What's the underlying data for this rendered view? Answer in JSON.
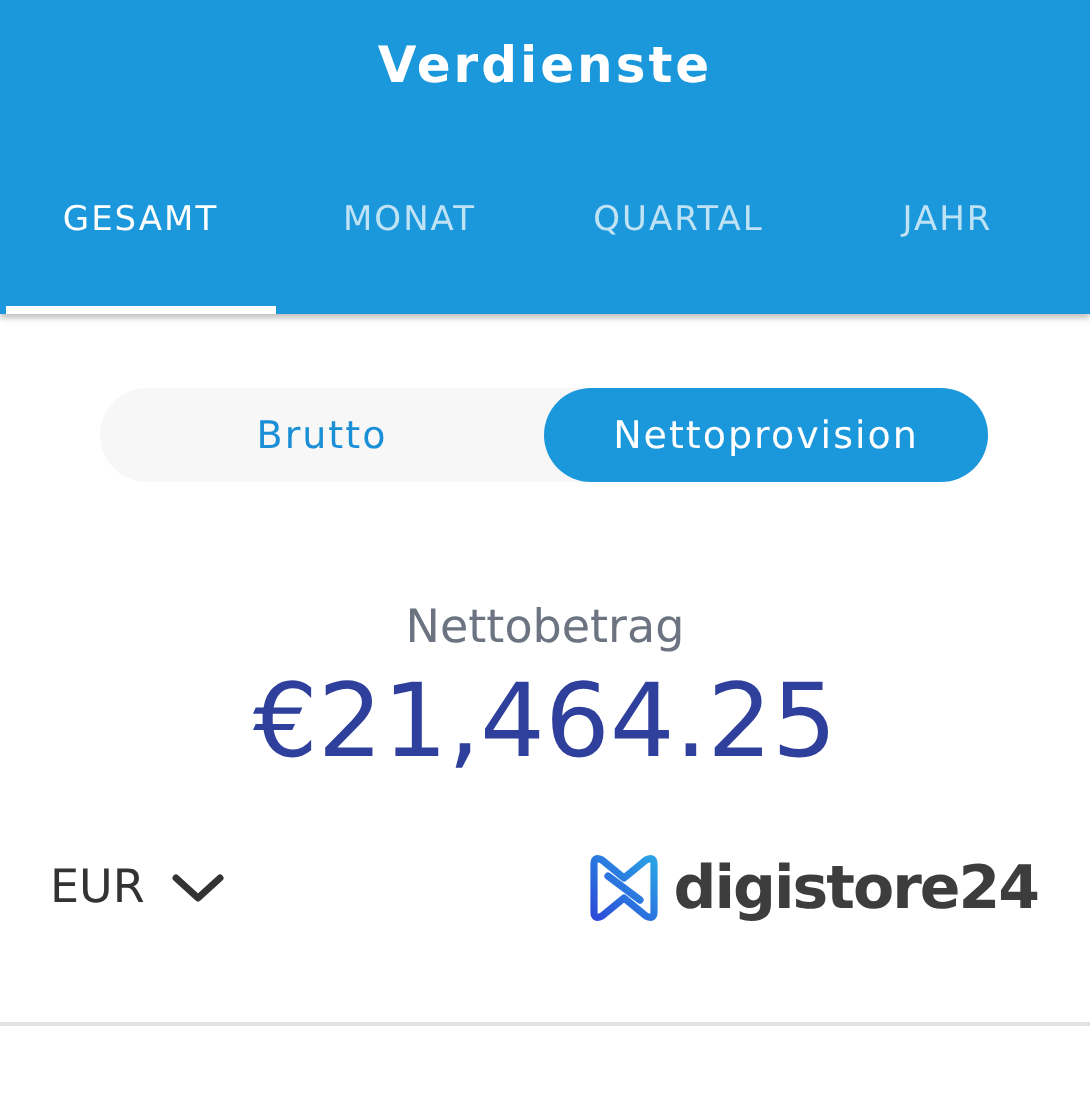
{
  "header": {
    "title": "Verdienste"
  },
  "tabs": [
    {
      "label": "GESAMT",
      "selected": true
    },
    {
      "label": "MONAT",
      "selected": false
    },
    {
      "label": "QUARTAL",
      "selected": false
    },
    {
      "label": "JAHR",
      "selected": false
    }
  ],
  "toggle": [
    {
      "label": "Brutto",
      "selected": false
    },
    {
      "label": "Nettoprovision",
      "selected": true
    }
  ],
  "amount": {
    "label": "Nettobetrag",
    "value": "€21,464.25"
  },
  "currency": {
    "value": "EUR"
  },
  "logo": {
    "text": "digistore24"
  }
}
